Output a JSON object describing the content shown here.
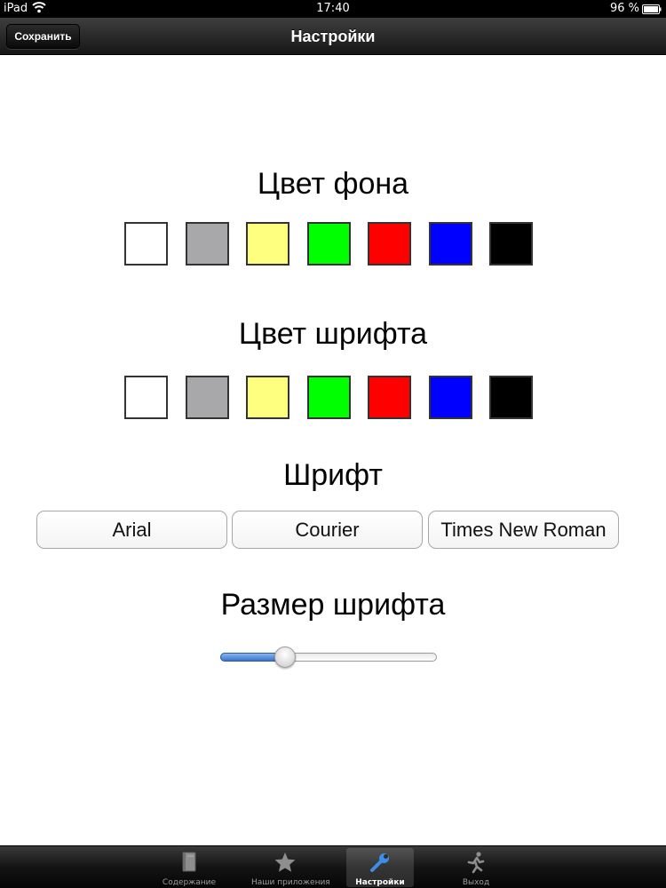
{
  "status_bar": {
    "carrier": "iPad",
    "time": "17:40",
    "battery": "96 %",
    "icons": [
      "wifi-icon",
      "battery-icon"
    ]
  },
  "nav_bar": {
    "title": "Настройки",
    "save_label": "Сохранить"
  },
  "background_color": {
    "title": "Цвет фона",
    "swatches": [
      {
        "name": "white",
        "color": "#ffffff"
      },
      {
        "name": "gray",
        "color": "#a8a7aa"
      },
      {
        "name": "yellow",
        "color": "#ffff7f"
      },
      {
        "name": "green",
        "color": "#00ff00"
      },
      {
        "name": "red",
        "color": "#ff0000"
      },
      {
        "name": "blue",
        "color": "#0000ff"
      },
      {
        "name": "black",
        "color": "#000000"
      }
    ]
  },
  "font_color": {
    "title": "Цвет шрифта",
    "swatches": [
      {
        "name": "white",
        "color": "#ffffff"
      },
      {
        "name": "gray",
        "color": "#a8a7aa"
      },
      {
        "name": "yellow",
        "color": "#ffff7f"
      },
      {
        "name": "green",
        "color": "#00ff00"
      },
      {
        "name": "red",
        "color": "#ff0000"
      },
      {
        "name": "blue",
        "color": "#0000ff"
      },
      {
        "name": "black",
        "color": "#000000"
      }
    ]
  },
  "font": {
    "title": "Шрифт",
    "options": [
      "Arial",
      "Courier",
      "Times New Roman"
    ]
  },
  "font_size": {
    "title": "Размер шрифта",
    "slider_value": 0.3
  },
  "tab_bar": {
    "tabs": [
      {
        "label": "Содержание",
        "icon": "book-icon",
        "selected": false
      },
      {
        "label": "Наши приложения",
        "icon": "star-icon",
        "selected": false
      },
      {
        "label": "Настройки",
        "icon": "wrench-icon",
        "selected": true
      },
      {
        "label": "Выход",
        "icon": "running-man-icon",
        "selected": false
      }
    ]
  }
}
